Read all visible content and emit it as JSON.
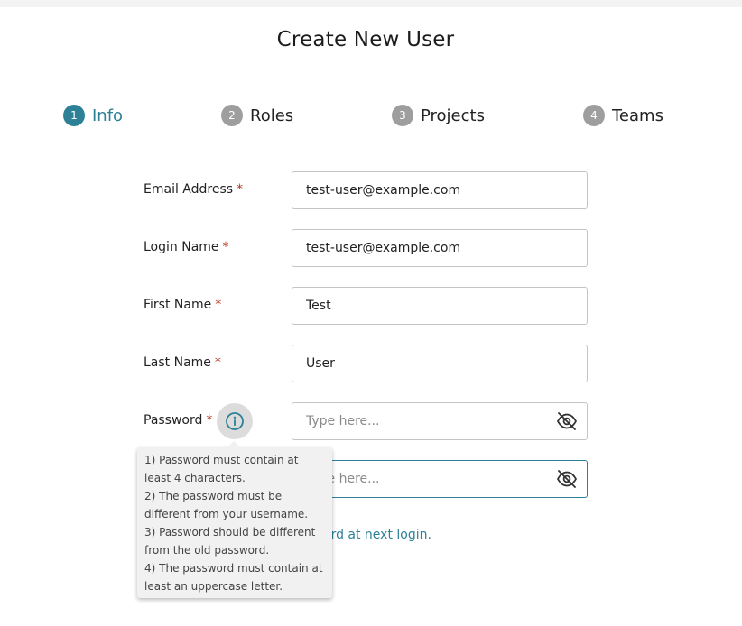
{
  "page": {
    "title": "Create New User"
  },
  "steps": [
    {
      "num": "1",
      "label": "Info"
    },
    {
      "num": "2",
      "label": "Roles"
    },
    {
      "num": "3",
      "label": "Projects"
    },
    {
      "num": "4",
      "label": "Teams"
    }
  ],
  "form": {
    "email": {
      "label": "Email Address",
      "value": "test-user@example.com"
    },
    "login": {
      "label": "Login Name",
      "value": "test-user@example.com"
    },
    "first": {
      "label": "First Name",
      "value": "Test"
    },
    "last": {
      "label": "Last Name",
      "value": "User"
    },
    "password": {
      "label": "Password",
      "placeholder": "Type here..."
    },
    "confirm": {
      "placeholder": "Type here..."
    },
    "required_mark": "*",
    "change_password_text": "ord at next login."
  },
  "tooltip": {
    "lines": [
      "1) Password must contain at",
      "least 4 characters.",
      "2) The password must be",
      "different from your username.",
      "3) Password should be different",
      "from the old password.",
      "4) The password must contain at",
      "least an uppercase letter."
    ]
  },
  "colors": {
    "accent": "#2c8197",
    "required": "#b8321e",
    "step_inactive": "#9e9e9e"
  },
  "icons": {
    "info": "info-circle-icon",
    "eye": "eye-off-icon"
  }
}
